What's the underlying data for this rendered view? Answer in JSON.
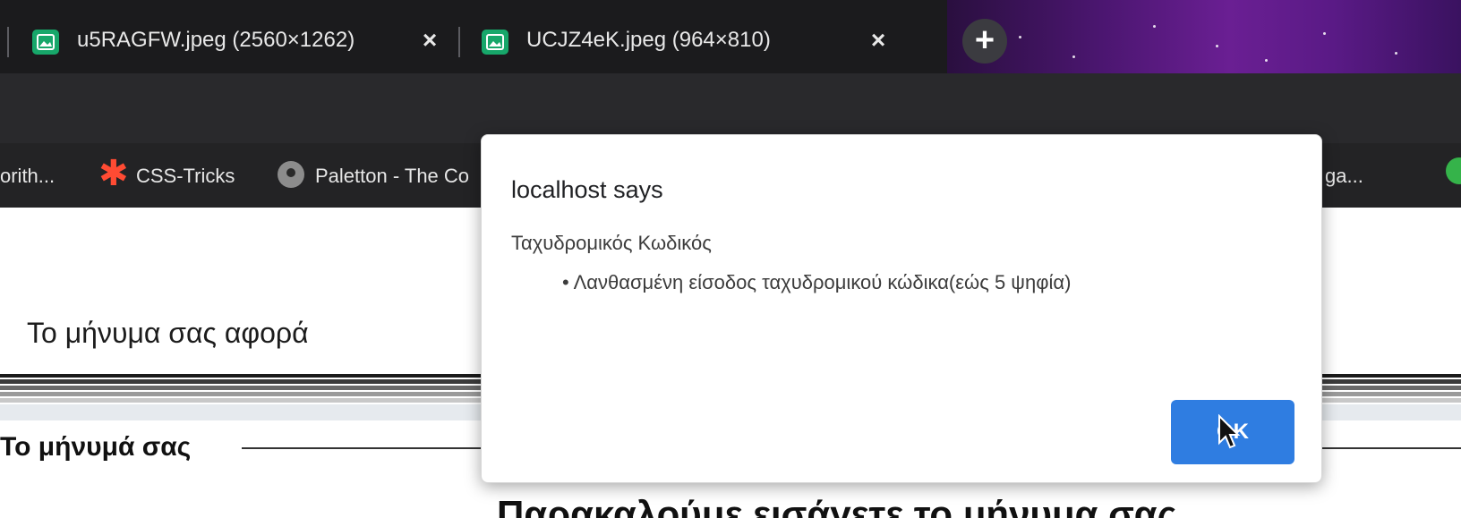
{
  "browser": {
    "tabs": [
      {
        "title": "u5RAGFW.jpeg (2560×1262)",
        "close": "×"
      },
      {
        "title": "UCJZ4eK.jpeg (964×810)",
        "close": "×"
      }
    ],
    "new_tab_symbol": "+",
    "bookmarks": [
      {
        "label": "orith..."
      },
      {
        "label": "CSS-Tricks"
      },
      {
        "label": "Paletton - The Co"
      },
      {
        "label": "ga..."
      }
    ]
  },
  "page": {
    "subject_label": "Το μήνυμα σας αφορά",
    "message_legend": "Το μήνυμά σας",
    "partial_heading": "Παρακαλούμε εισάγετε το μήνυμα σας"
  },
  "dialog": {
    "title": "localhost says",
    "field": "Ταχυδρομικός Κωδικός",
    "error": "• Λανθασμένη είσοδος ταχυδρομικού κώδικα(εώς 5 ψηφία)",
    "ok_label": "OK"
  },
  "colors": {
    "tabstrip": "#1b1b1d",
    "toolbar": "#29292c",
    "bookmarks_bar": "#232325",
    "favicon": "#17a76a",
    "ok_button": "#2f7de1",
    "css_tricks_star": "#ff4b33"
  },
  "icons": {
    "tab_favicon": "image-icon",
    "new_tab": "plus-icon",
    "css_tricks": "asterisk-icon",
    "paletton": "circle-icon",
    "cursor": "mouse-pointer-icon"
  }
}
